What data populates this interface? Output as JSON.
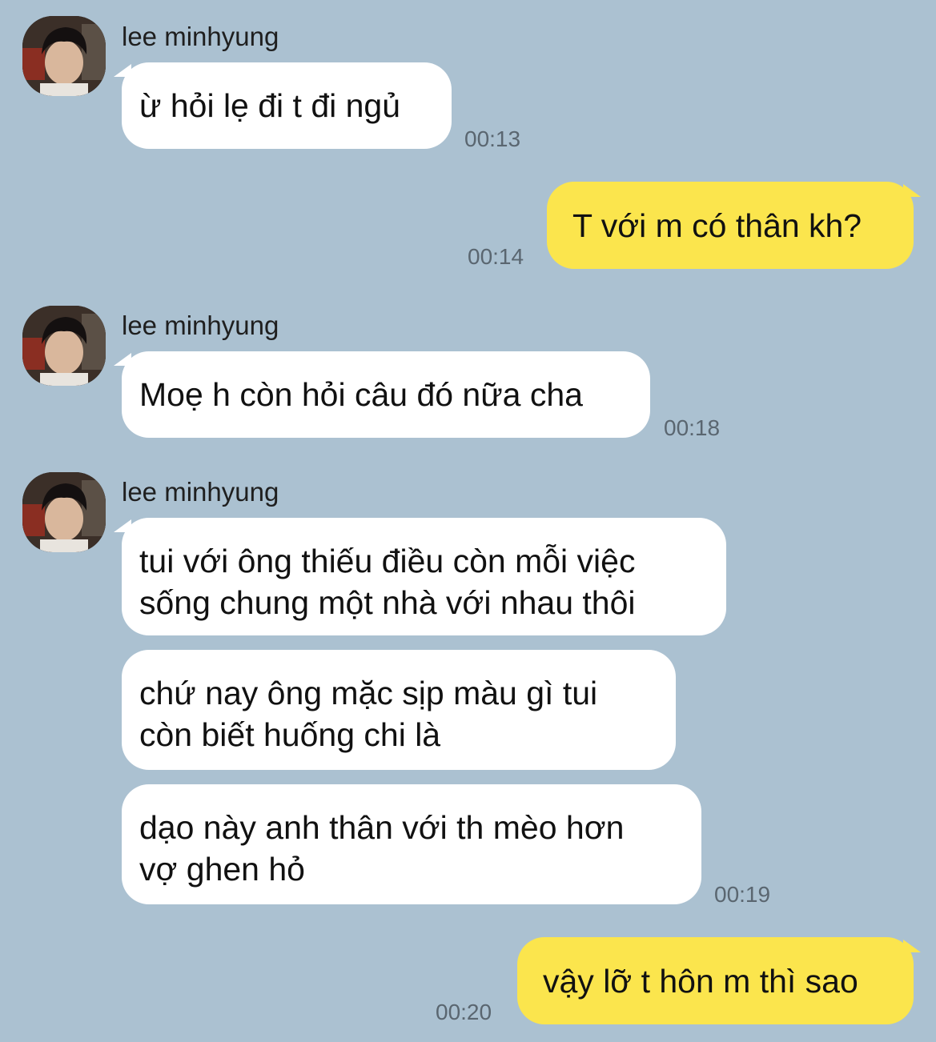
{
  "contact": {
    "name": "lee minhyung"
  },
  "colors": {
    "background": "#abc1d1",
    "incoming_bubble": "#ffffff",
    "outgoing_bubble": "#fbe54d",
    "timestamp": "#5a6670"
  },
  "messages": [
    {
      "direction": "incoming",
      "sender": "lee minhyung",
      "lines": [
        "ừ hỏi lẹ đi t đi ngủ"
      ],
      "time": "00:13"
    },
    {
      "direction": "outgoing",
      "lines": [
        "T với m có thân kh?"
      ],
      "time": "00:14"
    },
    {
      "direction": "incoming",
      "sender": "lee minhyung",
      "lines": [
        "Moẹ h còn hỏi câu đó nữa cha"
      ],
      "time": "00:18"
    },
    {
      "direction": "incoming",
      "sender": "lee minhyung",
      "lines": [
        "tui với ông thiếu điều còn mỗi việc",
        "sống chung một nhà với nhau thôi"
      ],
      "time": ""
    },
    {
      "direction": "incoming",
      "lines": [
        "chứ nay ông mặc sịp màu gì tui",
        "còn biết huống chi là"
      ],
      "time": ""
    },
    {
      "direction": "incoming",
      "lines": [
        "dạo này anh thân với th mèo hơn",
        "vợ ghen hỏ"
      ],
      "time": "00:19"
    },
    {
      "direction": "outgoing",
      "lines": [
        "vậy lỡ t hôn m thì sao"
      ],
      "time": "00:20"
    }
  ]
}
